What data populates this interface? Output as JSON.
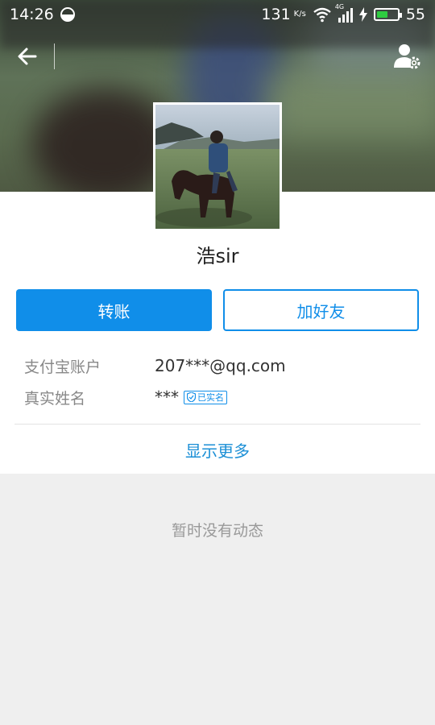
{
  "status_bar": {
    "time": "14:26",
    "net_speed": "131",
    "net_speed_unit": "K/s",
    "signal_type": "4G",
    "battery": "55",
    "battery_level": 0.55
  },
  "icons": {
    "back": "back-arrow-icon",
    "settings": "user-settings-icon",
    "verified": "verified-icon"
  },
  "profile": {
    "name": "浩sir",
    "primary_button": "转账",
    "secondary_button": "加好友",
    "info": [
      {
        "label": "支付宝账户",
        "value": "207***@qq.com"
      },
      {
        "label": "真实姓名",
        "value": "***"
      }
    ],
    "verified_label": "已实名",
    "show_more": "显示更多"
  },
  "feed": {
    "empty_message": "暂时没有动态"
  },
  "colors": {
    "accent": "#108ee9",
    "link": "#1b8fd6",
    "page_bg": "#efefef"
  }
}
